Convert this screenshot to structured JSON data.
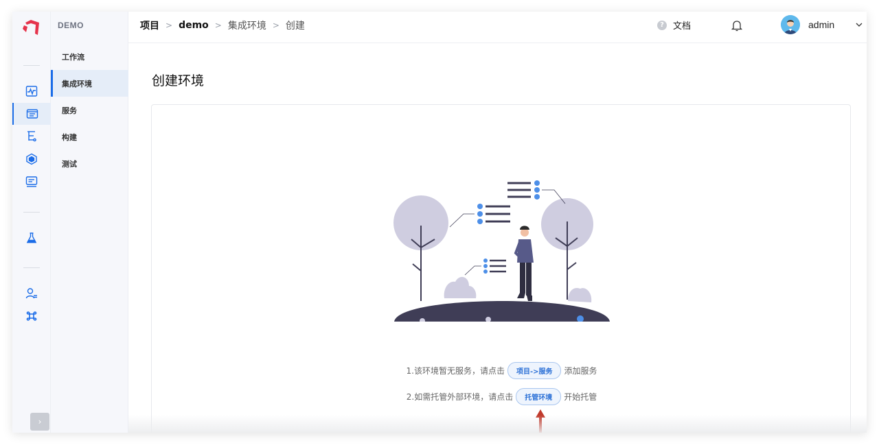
{
  "sidebar": {
    "project_name": "DEMO",
    "items": [
      {
        "label": "工作流"
      },
      {
        "label": "集成环境"
      },
      {
        "label": "服务"
      },
      {
        "label": "构建"
      },
      {
        "label": "测试"
      }
    ],
    "rail_icons": [
      "activity-icon",
      "project-list-icon",
      "tree-icon",
      "cube-icon",
      "board-icon",
      "flask-icon",
      "user-list-icon",
      "command-icon"
    ],
    "collapse_label": "›"
  },
  "header": {
    "breadcrumb": [
      {
        "label": "项目"
      },
      {
        "label": "demo"
      },
      {
        "label": "集成环境"
      },
      {
        "label": "创建"
      }
    ],
    "separator": ">",
    "help_glyph": "?",
    "docs_label": "文档",
    "user_name": "admin"
  },
  "main": {
    "title": "创建环境",
    "tip1": {
      "prefix": "1.该环境暂无服务，请点击",
      "button": "项目->服务",
      "suffix": "添加服务"
    },
    "tip2": {
      "prefix": "2.如需托管外部环境，请点击",
      "button": "托管环境",
      "suffix": "开始托管"
    }
  },
  "colors": {
    "accent": "#1a6ce8",
    "logo": "#e5334b",
    "annotation_arrow": "#c0392b"
  }
}
